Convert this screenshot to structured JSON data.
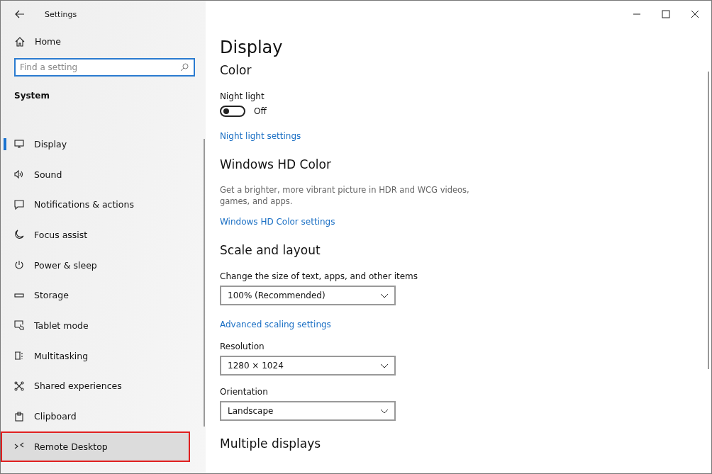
{
  "window": {
    "title": "Settings"
  },
  "sidebar": {
    "home": "Home",
    "search": {
      "placeholder": "Find a setting"
    },
    "section": "System",
    "items": [
      {
        "label": "Display",
        "selected": true,
        "highlighted": false
      },
      {
        "label": "Sound",
        "selected": false,
        "highlighted": false
      },
      {
        "label": "Notifications & actions",
        "selected": false,
        "highlighted": false
      },
      {
        "label": "Focus assist",
        "selected": false,
        "highlighted": false
      },
      {
        "label": "Power & sleep",
        "selected": false,
        "highlighted": false
      },
      {
        "label": "Storage",
        "selected": false,
        "highlighted": false
      },
      {
        "label": "Tablet mode",
        "selected": false,
        "highlighted": false
      },
      {
        "label": "Multitasking",
        "selected": false,
        "highlighted": false
      },
      {
        "label": "Shared experiences",
        "selected": false,
        "highlighted": false
      },
      {
        "label": "Clipboard",
        "selected": false,
        "highlighted": false
      },
      {
        "label": "Remote Desktop",
        "selected": false,
        "highlighted": true
      }
    ]
  },
  "content": {
    "title": "Display",
    "sections": [
      {
        "heading": "Color",
        "blocks": [
          {
            "kind": "toggle",
            "label": "Night light",
            "on": false,
            "state": "Off"
          },
          {
            "kind": "link",
            "text": "Night light settings"
          }
        ]
      },
      {
        "heading": "Windows HD Color",
        "blocks": [
          {
            "kind": "text",
            "text": "Get a brighter, more vibrant picture in HDR and WCG videos, games, and apps."
          },
          {
            "kind": "link",
            "text": "Windows HD Color settings"
          }
        ]
      },
      {
        "heading": "Scale and layout",
        "blocks": [
          {
            "kind": "dropdown",
            "label": "Change the size of text, apps, and other items",
            "value": "100% (Recommended)"
          },
          {
            "kind": "link",
            "text": "Advanced scaling settings"
          },
          {
            "kind": "dropdown",
            "label": "Resolution",
            "value": "1280 × 1024"
          },
          {
            "kind": "dropdown",
            "label": "Orientation",
            "value": "Landscape"
          }
        ]
      },
      {
        "heading": "Multiple displays"
      }
    ]
  }
}
